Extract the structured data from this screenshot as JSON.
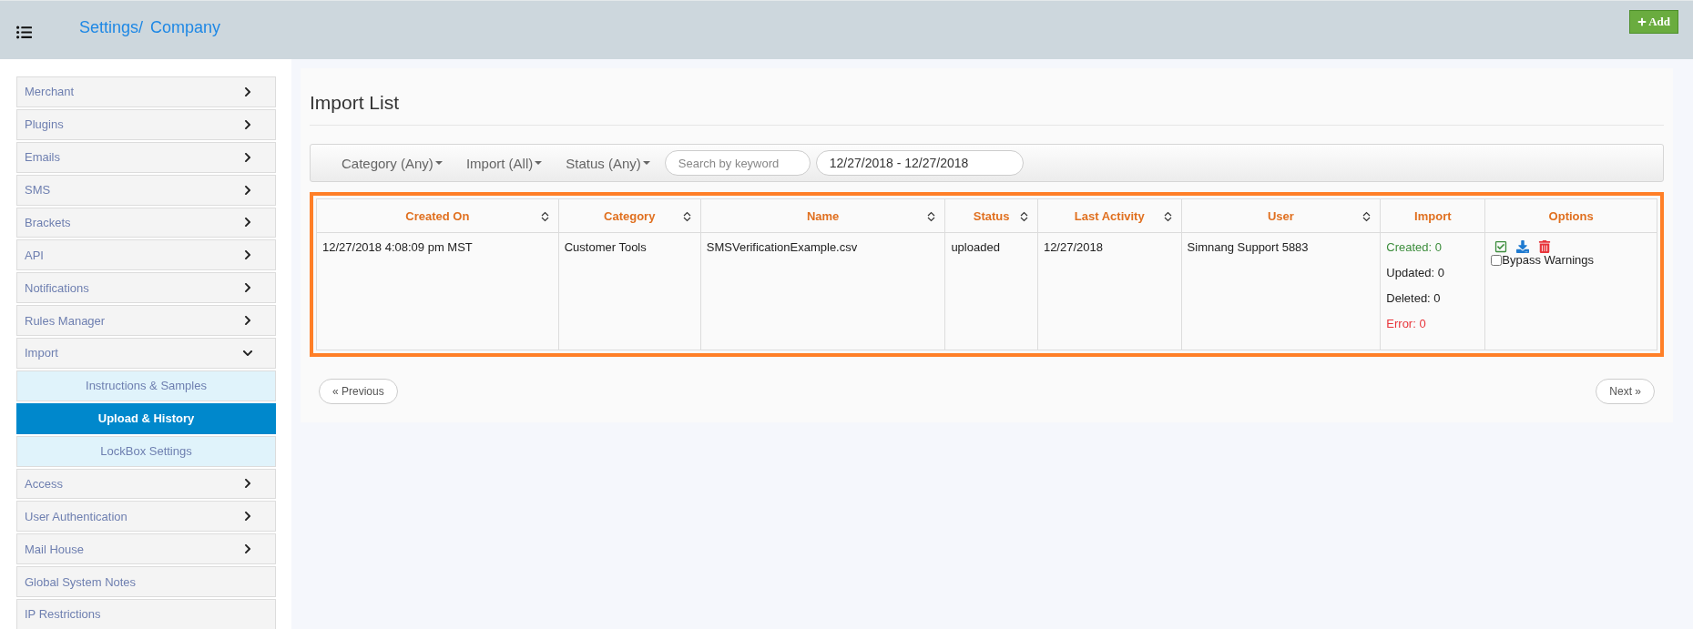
{
  "header": {
    "breadcrumb": [
      {
        "label": "Settings/"
      },
      {
        "label": "Company"
      }
    ],
    "add_button": "Add"
  },
  "sidebar": {
    "items": [
      {
        "label": "Merchant",
        "kind": "group",
        "expanded": false
      },
      {
        "label": "Plugins",
        "kind": "group",
        "expanded": false
      },
      {
        "label": "Emails",
        "kind": "group",
        "expanded": false
      },
      {
        "label": "SMS",
        "kind": "group",
        "expanded": false
      },
      {
        "label": "Brackets",
        "kind": "group",
        "expanded": false
      },
      {
        "label": "API",
        "kind": "group",
        "expanded": false
      },
      {
        "label": "Notifications",
        "kind": "group",
        "expanded": false
      },
      {
        "label": "Rules Manager",
        "kind": "group",
        "expanded": false
      },
      {
        "label": "Import",
        "kind": "group",
        "expanded": true,
        "children": [
          {
            "label": "Instructions & Samples",
            "selected": false
          },
          {
            "label": "Upload & History",
            "selected": true
          },
          {
            "label": "LockBox Settings",
            "selected": false
          }
        ]
      },
      {
        "label": "Access",
        "kind": "group",
        "expanded": false
      },
      {
        "label": "User Authentication",
        "kind": "group",
        "expanded": false
      },
      {
        "label": "Mail House",
        "kind": "group",
        "expanded": false
      },
      {
        "label": "Global System Notes",
        "kind": "link"
      },
      {
        "label": "IP Restrictions",
        "kind": "link"
      }
    ]
  },
  "main": {
    "title": "Import List",
    "filters": {
      "dropdowns": [
        "Category (Any)",
        "Import (All)",
        "Status (Any)"
      ],
      "search": {
        "placeholder": "Search by keyword"
      },
      "date_range": "12/27/2018 - 12/27/2018"
    },
    "table": {
      "highlighted": true,
      "columns": [
        {
          "label": "Created On",
          "sortable": true
        },
        {
          "label": "Category",
          "sortable": true
        },
        {
          "label": "Name",
          "sortable": true
        },
        {
          "label": "Status",
          "sortable": true
        },
        {
          "label": "Last Activity",
          "sortable": true
        },
        {
          "label": "User",
          "sortable": true
        },
        {
          "label": "Import",
          "sortable": false
        },
        {
          "label": "Options",
          "sortable": false
        }
      ],
      "rows": [
        {
          "cells": [
            "12/27/2018 4:08:09 pm MST",
            "Customer Tools",
            "SMSVerificationExample.csv",
            "uploaded",
            "12/27/2018",
            "Simnang Support 5883"
          ],
          "import": [
            {
              "kind": "created",
              "text": "Created: 0"
            },
            {
              "kind": "updated",
              "text": "Updated: 0"
            },
            {
              "kind": "deleted",
              "text": "Deleted: 0"
            },
            {
              "kind": "error",
              "text": "Error: 0"
            }
          ],
          "options": {
            "bypass_label": "Bypass Warnings",
            "bypass_checked": false
          }
        }
      ]
    },
    "pagination": {
      "previous": "« Previous",
      "next": "Next »"
    }
  }
}
